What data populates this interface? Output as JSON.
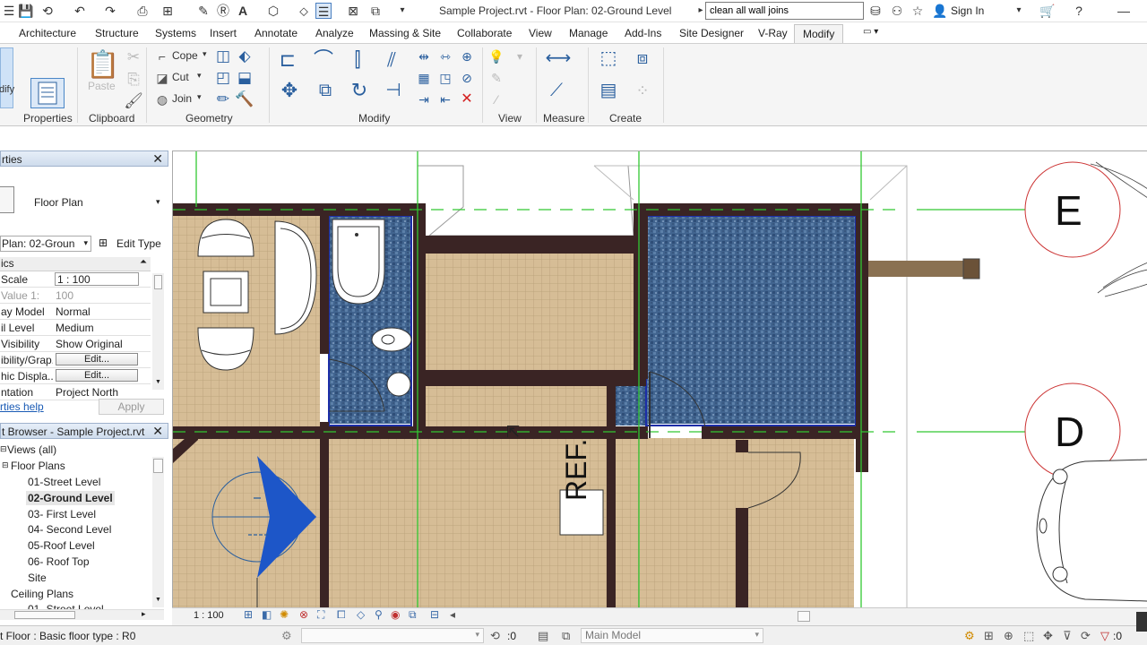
{
  "titlebar": {
    "document_title": "Sample Project.rvt - Floor Plan: 02-Ground Level",
    "search_value": "clean all wall joins",
    "sign_in": "Sign In"
  },
  "tabs": [
    "Architecture",
    "Structure",
    "Systems",
    "Insert",
    "Annotate",
    "Analyze",
    "Massing & Site",
    "Collaborate",
    "View",
    "Manage",
    "Add-Ins",
    "Site Designer",
    "V-Ray",
    "Modify"
  ],
  "active_tab": "Modify",
  "ribbon": {
    "modify_left": "dify",
    "panels": [
      "Properties",
      "Clipboard",
      "Geometry",
      "Modify",
      "View",
      "Measure",
      "Create"
    ],
    "paste": "Paste",
    "cope": "Cope",
    "cut": "Cut",
    "join": "Join"
  },
  "properties": {
    "header": "rties",
    "type_name": "Floor Plan",
    "view_selector": "Plan: 02-Groun",
    "edit_type": "Edit Type",
    "section": "ics",
    "rows": [
      {
        "key": "Scale",
        "value": "1 : 100"
      },
      {
        "key": "Value  1:",
        "value": "100"
      },
      {
        "key": "ay Model",
        "value": "Normal"
      },
      {
        "key": "il Level",
        "value": "Medium"
      },
      {
        "key": "Visibility",
        "value": "Show Original"
      },
      {
        "key": "ibility/Grap...",
        "value": "Edit..."
      },
      {
        "key": "hic Displa...",
        "value": "Edit..."
      },
      {
        "key": "ntation",
        "value": "Project North"
      }
    ],
    "help_link": "rties help",
    "apply": "Apply"
  },
  "browser": {
    "header": "t Browser - Sample Project.rvt",
    "items": [
      {
        "label": "Views (all)",
        "indent": 0
      },
      {
        "label": "Floor Plans",
        "indent": 1
      },
      {
        "label": "01-Street Level",
        "indent": 2
      },
      {
        "label": "02-Ground Level",
        "indent": 2,
        "selected": true
      },
      {
        "label": "03- First Level",
        "indent": 2
      },
      {
        "label": "04- Second Level",
        "indent": 2
      },
      {
        "label": "05-Roof Level",
        "indent": 2
      },
      {
        "label": "06- Roof Top",
        "indent": 2
      },
      {
        "label": "Site",
        "indent": 2
      },
      {
        "label": "Ceiling Plans",
        "indent": 1
      },
      {
        "label": "01- Street Level",
        "indent": 2
      }
    ]
  },
  "canvas": {
    "grid_labels": [
      "E",
      "D"
    ],
    "ref_label": "REF."
  },
  "viewbar": {
    "scale": "1 : 100"
  },
  "statusbar": {
    "status": "t Floor : Basic floor type : R0",
    "zero1": ":0",
    "model": "Main Model",
    "zero2": ":0"
  },
  "colors": {
    "accent_blue": "#2a5f9e",
    "wall": "#3a2424",
    "floor_tile": "#d6bd96",
    "bath_tile": "#41648f",
    "grid_line": "#32c832",
    "grid_bubble": "#cc3333"
  }
}
